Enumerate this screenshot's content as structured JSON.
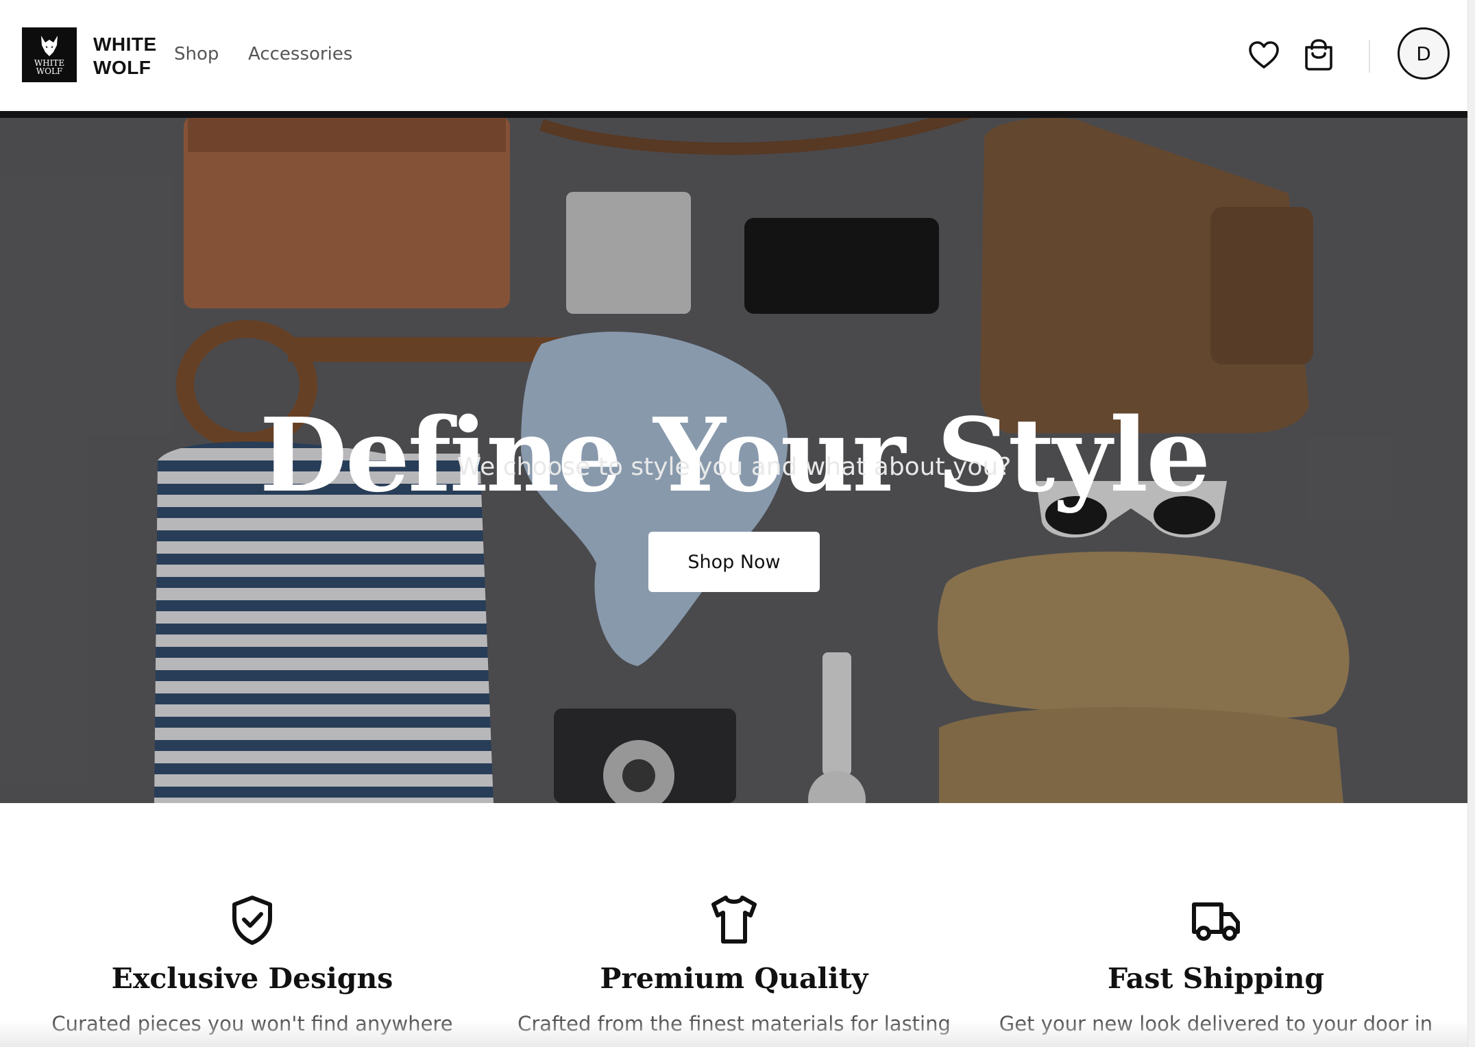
{
  "header": {
    "logo_text_line1": "WHITE",
    "logo_text_line2": "WOLF",
    "brand_line1": "WHITE",
    "brand_line2": "WOLF",
    "nav": [
      {
        "label": "Shop"
      },
      {
        "label": "Accessories"
      }
    ],
    "wishlist_icon": "heart-icon",
    "cart_icon": "shopping-bag-icon",
    "avatar_initial": "D"
  },
  "hero": {
    "title": "Define Your Style",
    "subtitle": "We choose to style you and what about you?",
    "cta_label": "Shop Now"
  },
  "features": [
    {
      "icon": "shield-check-icon",
      "title": "Exclusive Designs",
      "text": "Curated pieces you won't find anywhere"
    },
    {
      "icon": "tshirt-icon",
      "title": "Premium Quality",
      "text": "Crafted from the finest materials for lasting"
    },
    {
      "icon": "truck-icon",
      "title": "Fast Shipping",
      "text": "Get your new look delivered to your door in"
    }
  ],
  "colors": {
    "brand_black": "#0d0d0d",
    "hero_background": "#565659",
    "button_background": "#ffffff",
    "text_muted": "#555555"
  }
}
